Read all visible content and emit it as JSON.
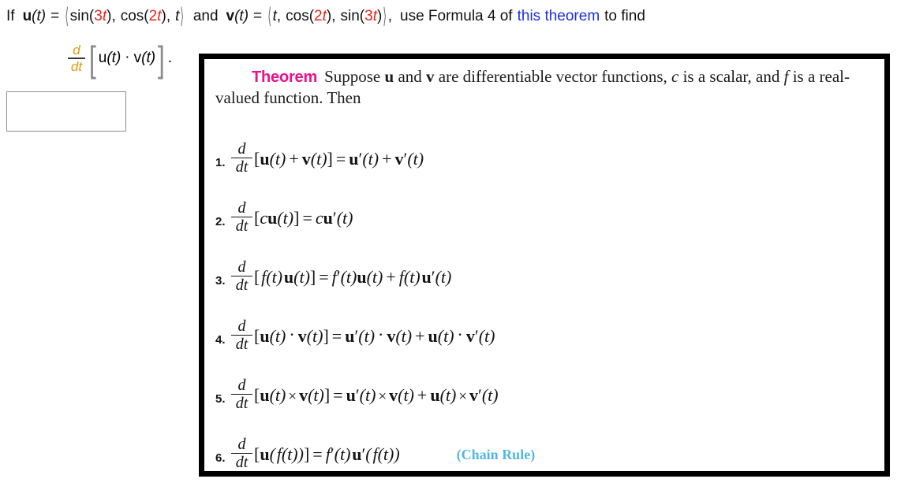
{
  "prompt": {
    "lead": "If",
    "u_label": "u",
    "v_label": "v",
    "arg": "(t)",
    "equals": "=",
    "u_components": [
      "sin(3t)",
      "cos(2t)",
      "t"
    ],
    "v_components": [
      "t",
      "cos(2t)",
      "sin(3t)"
    ],
    "and_word": "and",
    "comma": ",",
    "instruction_before_link": "use Formula 4 of",
    "link_text": "this theorem",
    "instruction_after_link": "to find",
    "u_text": "u(t) = ⟨sin(3t), cos(2t), t⟩",
    "v_text": "v(t) = ⟨t, cos(2t), sin(3t)⟩",
    "red_coefficients": [
      "3",
      "2",
      "2",
      "3"
    ],
    "link_color": "#1a2fe0",
    "red_color": "#e8231a"
  },
  "derivative": {
    "numerator": "d",
    "denominator": "dt",
    "bracket_open": "[",
    "bracket_close": "]",
    "expression": "u(t) · v(t)",
    "u_label": "u",
    "v_label": "v",
    "arg": "(t)",
    "dot": "·",
    "trailing_period": ".",
    "fraction_color": "#e8960f"
  },
  "answer_input": {
    "value": "",
    "placeholder": ""
  },
  "theorem": {
    "title": "Theorem",
    "title_color": "#ec0f8c",
    "intro_part1": "Suppose",
    "intro_u": "u",
    "intro_and": "and",
    "intro_v": "v",
    "intro_part2": "are differentiable vector functions,",
    "intro_c": "c",
    "intro_part3": "is a scalar,",
    "intro_line2_part1": "and",
    "intro_f": "f",
    "intro_line2_part2": "is a real-valued function. Then",
    "full_text": "Theorem  Suppose u and v are differentiable vector functions, c is a scalar, and f is a real-valued function. Then",
    "formulas": [
      {
        "number": "1.",
        "num": "d",
        "den": "dt",
        "lhs_open": "[",
        "lhs": "u(t) + v(t)",
        "lhs_close": "]",
        "eq": "=",
        "rhs": "u′(t) + v′(t)",
        "note": ""
      },
      {
        "number": "2.",
        "num": "d",
        "den": "dt",
        "lhs_open": "[",
        "lhs": "cu(t)",
        "lhs_close": "]",
        "eq": "=",
        "rhs": "cu′(t)",
        "note": ""
      },
      {
        "number": "3.",
        "num": "d",
        "den": "dt",
        "lhs_open": "[",
        "lhs": "f(t)u(t)",
        "lhs_close": "]",
        "eq": "=",
        "rhs": "f′(t)u(t) + f(t)u′(t)",
        "note": ""
      },
      {
        "number": "4.",
        "num": "d",
        "den": "dt",
        "lhs_open": "[",
        "lhs": "u(t) · v(t)",
        "lhs_close": "]",
        "eq": "=",
        "rhs": "u′(t) · v(t) + u(t) · v′(t)",
        "note": ""
      },
      {
        "number": "5.",
        "num": "d",
        "den": "dt",
        "lhs_open": "[",
        "lhs": "u(t) × v(t)",
        "lhs_close": "]",
        "eq": "=",
        "rhs": "u′(t) × v(t) + u(t) × v′(t)",
        "note": ""
      },
      {
        "number": "6.",
        "num": "d",
        "den": "dt",
        "lhs_open": "[",
        "lhs": "u(f(t))",
        "lhs_close": "]",
        "eq": "=",
        "rhs": "f′(t)u′(f(t))",
        "note": "(Chain Rule)",
        "note_color": "#53b6e8"
      }
    ]
  }
}
